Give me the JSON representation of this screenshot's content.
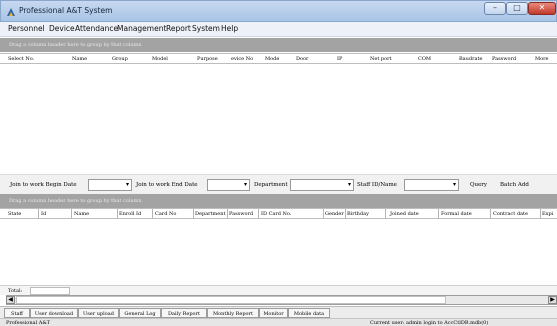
{
  "window": {
    "title": "Professional A&T System",
    "min": "–",
    "max": "□",
    "close": "✕"
  },
  "menu": [
    "Personnel",
    "Device",
    "Attendance",
    "Management",
    "Report",
    "System",
    "Help"
  ],
  "group_top": "Drag a column header here to group by that column",
  "device_columns": [
    "Select No.",
    "Name",
    "Group",
    "Model",
    "Purpose",
    "evice No",
    "Mode",
    "Door",
    "IP",
    "Net port",
    "COM",
    "Baudrate",
    "Password",
    "More"
  ],
  "filters": {
    "begin_label": "Join to work Begin Date",
    "end_label": "Join to work End Date",
    "department_label": "Department",
    "staff_label": "Staff ID/Name",
    "query_button": "Query",
    "batch_add_button": "Batch Add"
  },
  "group_bottom": "Drag a column header here to group by that column",
  "staff_columns": [
    "State",
    "Id",
    "Name",
    "Enroll Id",
    "Card No",
    "Department",
    "Password",
    "ID Card No.",
    "Gender",
    "Birthday",
    "Joined date",
    "Formal date",
    "Contract date",
    "Expi"
  ],
  "total_label": "Total:",
  "tabs": [
    "Staff",
    "User download",
    "User upload",
    "General Log",
    "Daily Report",
    "Monthly Report",
    "Monitor",
    "Mobile data"
  ],
  "status": {
    "left": "Professional A&T",
    "right": "Current user: admin  login to AccCtlDB.mdb(0)"
  },
  "colors": {
    "title_bar": "#a9c4e6",
    "group_bar": "#a3a3a3",
    "close_button": "#c0392b"
  }
}
